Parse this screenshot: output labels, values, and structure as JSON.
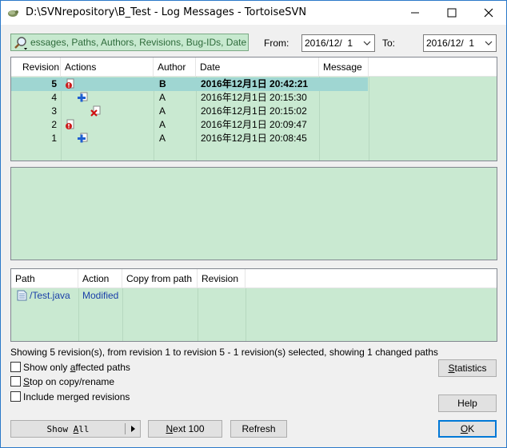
{
  "window": {
    "title": "D:\\SVNrepository\\B_Test - Log Messages - TortoiseSVN",
    "controls": [
      "minimize-icon",
      "maximize-icon",
      "close-icon"
    ]
  },
  "filter": {
    "value": "essages, Paths, Authors, Revisions, Bug-IDs, Date,",
    "icon": "search-icon"
  },
  "date_range": {
    "from_label": "From:",
    "from_value": "2016/12/  1",
    "to_label": "To:",
    "to_value": "2016/12/  1"
  },
  "revisions": {
    "columns": [
      "Revision",
      "Actions",
      "Author",
      "Date",
      "Message"
    ],
    "rows": [
      {
        "revision": "5",
        "actions": [
          "modified"
        ],
        "author": "B",
        "date": "2016年12月1日 20:42:21",
        "message": "",
        "selected": true
      },
      {
        "revision": "4",
        "actions": [
          "added"
        ],
        "author": "A",
        "date": "2016年12月1日 20:15:30",
        "message": "",
        "selected": false
      },
      {
        "revision": "3",
        "actions": [
          "deleted"
        ],
        "author": "A",
        "date": "2016年12月1日 20:15:02",
        "message": "",
        "selected": false
      },
      {
        "revision": "2",
        "actions": [
          "modified"
        ],
        "author": "A",
        "date": "2016年12月1日 20:09:47",
        "message": "",
        "selected": false
      },
      {
        "revision": "1",
        "actions": [
          "added"
        ],
        "author": "A",
        "date": "2016年12月1日 20:08:45",
        "message": "",
        "selected": false
      }
    ]
  },
  "paths": {
    "columns": [
      "Path",
      "Action",
      "Copy from path",
      "Revision"
    ],
    "rows": [
      {
        "path": "/Test.java",
        "action": "Modified",
        "copy_from": "",
        "revision": "",
        "icon": "file-icon"
      }
    ]
  },
  "status_text": "Showing 5 revision(s), from revision 1 to revision 5 - 1 revision(s) selected, showing 1 changed paths",
  "options": {
    "affected_pre": "Show only ",
    "affected_u": "a",
    "affected_post": "ffected paths",
    "stop_u": "S",
    "stop_post": "top on copy/rename",
    "merged_pre": "Include merged revisions"
  },
  "buttons": {
    "statistics_u": "S",
    "statistics_post": "tatistics",
    "help": "Help",
    "show_all_pre": "Show ",
    "show_all_u": "A",
    "show_all_post": "ll",
    "next100_u": "N",
    "next100_post": "ext 100",
    "refresh": "Refresh",
    "ok_u": "O",
    "ok_post": "K"
  },
  "colors": {
    "list_bg": "#c9e9d1",
    "selected_row": "#9fd6d2",
    "link": "#1a3fa8",
    "added_icon": "#1f5fd0",
    "deleted_icon": "#d01010",
    "modified_icon": "#cc1a1a"
  }
}
